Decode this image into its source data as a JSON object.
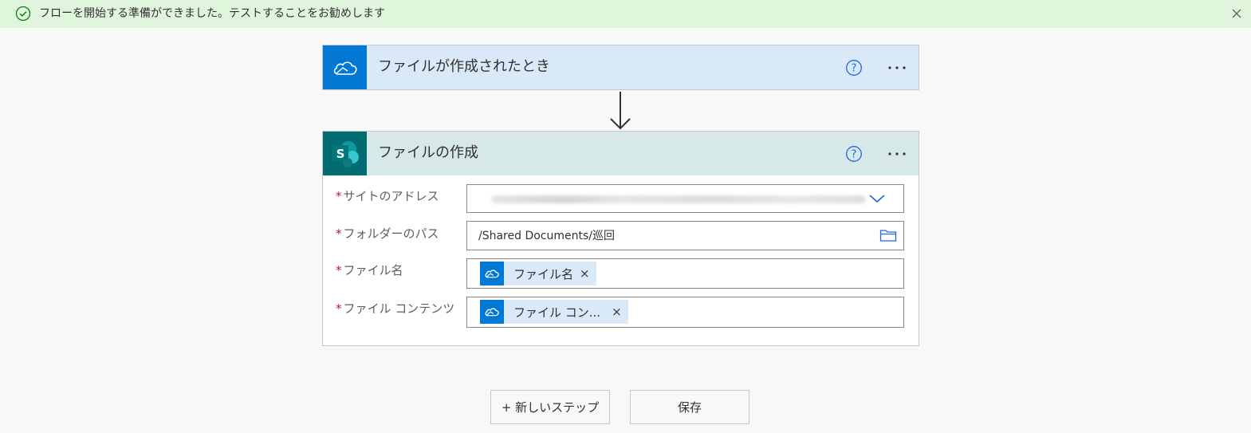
{
  "banner": {
    "message": "フローを開始する準備ができました。テストすることをお勧めします",
    "status_color": "#dff6dd",
    "icons": {
      "status": "check-circle-icon",
      "close": "close-icon"
    }
  },
  "trigger": {
    "title": "ファイルが作成されたとき",
    "connector_icon": "onedrive-cloud-icon",
    "connector_color": "#0078d4",
    "header_color": "#dae9f7"
  },
  "action": {
    "title": "ファイルの作成",
    "connector_icon": "sharepoint-icon",
    "connector_color": "#036c70",
    "header_color": "#d7e8e8",
    "fields": [
      {
        "label": "サイトのアドレス",
        "required_mark": "*"
      },
      {
        "label": "フォルダーのパス",
        "required_mark": "*",
        "value": "/Shared Documents/巡回"
      },
      {
        "label": "ファイル名",
        "required_mark": "*",
        "token": "ファイル名",
        "token_remove": "×"
      },
      {
        "label": "ファイル コンテンツ",
        "required_mark": "*",
        "token": "ファイル コン...",
        "token_remove": "×"
      }
    ]
  },
  "buttons": {
    "new_step": "+ 新しいステップ",
    "save": "保存"
  }
}
